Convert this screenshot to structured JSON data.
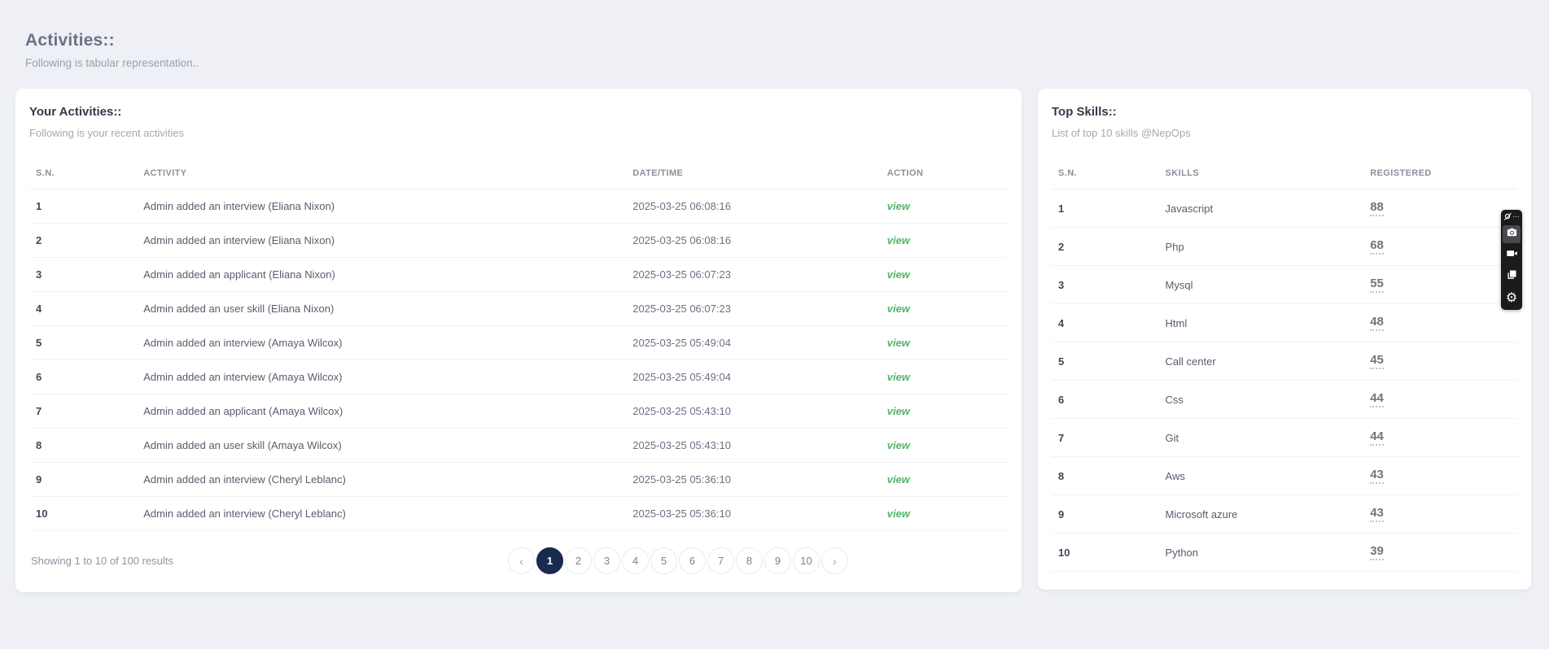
{
  "page": {
    "title": "Activities::",
    "subtitle": "Following is tabular representation.."
  },
  "activities_panel": {
    "title": "Your Activities::",
    "subtitle": "Following is your recent activities",
    "columns": [
      "S.N.",
      "ACTIVITY",
      "DATE/TIME",
      "ACTION"
    ],
    "rows": [
      {
        "sn": "1",
        "activity": "Admin added an interview (Eliana Nixon)",
        "datetime": "2025-03-25 06:08:16",
        "action": "view"
      },
      {
        "sn": "2",
        "activity": "Admin added an interview (Eliana Nixon)",
        "datetime": "2025-03-25 06:08:16",
        "action": "view"
      },
      {
        "sn": "3",
        "activity": "Admin added an applicant (Eliana Nixon)",
        "datetime": "2025-03-25 06:07:23",
        "action": "view"
      },
      {
        "sn": "4",
        "activity": "Admin added an user skill (Eliana Nixon)",
        "datetime": "2025-03-25 06:07:23",
        "action": "view"
      },
      {
        "sn": "5",
        "activity": "Admin added an interview (Amaya Wilcox)",
        "datetime": "2025-03-25 05:49:04",
        "action": "view"
      },
      {
        "sn": "6",
        "activity": "Admin added an interview (Amaya Wilcox)",
        "datetime": "2025-03-25 05:49:04",
        "action": "view"
      },
      {
        "sn": "7",
        "activity": "Admin added an applicant (Amaya Wilcox)",
        "datetime": "2025-03-25 05:43:10",
        "action": "view"
      },
      {
        "sn": "8",
        "activity": "Admin added an user skill (Amaya Wilcox)",
        "datetime": "2025-03-25 05:43:10",
        "action": "view"
      },
      {
        "sn": "9",
        "activity": "Admin added an interview (Cheryl Leblanc)",
        "datetime": "2025-03-25 05:36:10",
        "action": "view"
      },
      {
        "sn": "10",
        "activity": "Admin added an interview (Cheryl Leblanc)",
        "datetime": "2025-03-25 05:36:10",
        "action": "view"
      }
    ],
    "footer_summary": "Showing 1 to 10 of 100 results",
    "pagination": {
      "prev": "‹",
      "next": "›",
      "pages": [
        "1",
        "2",
        "3",
        "4",
        "5",
        "6",
        "7",
        "8",
        "9",
        "10"
      ],
      "active_page": "1"
    }
  },
  "skills_panel": {
    "title": "Top Skills::",
    "subtitle": "List of top 10 skills @NepOps",
    "columns": [
      "S.N.",
      "SKILLS",
      "REGISTERED"
    ],
    "rows": [
      {
        "sn": "1",
        "skill": "Javascript",
        "registered": "88"
      },
      {
        "sn": "2",
        "skill": "Php",
        "registered": "68"
      },
      {
        "sn": "3",
        "skill": "Mysql",
        "registered": "55"
      },
      {
        "sn": "4",
        "skill": "Html",
        "registered": "48"
      },
      {
        "sn": "5",
        "skill": "Call center",
        "registered": "45"
      },
      {
        "sn": "6",
        "skill": "Css",
        "registered": "44"
      },
      {
        "sn": "7",
        "skill": "Git",
        "registered": "44"
      },
      {
        "sn": "8",
        "skill": "Aws",
        "registered": "43"
      },
      {
        "sn": "9",
        "skill": "Microsoft azure",
        "registered": "43"
      },
      {
        "sn": "10",
        "skill": "Python",
        "registered": "39"
      }
    ]
  },
  "capture_toolbar": {
    "menu_dots": "⋯",
    "gear": "⚙"
  },
  "colors": {
    "background": "#eef0f6",
    "view_link_green": "#53b469",
    "active_page_navy": "#182a4e",
    "page_title_slate": "#6a7285"
  }
}
